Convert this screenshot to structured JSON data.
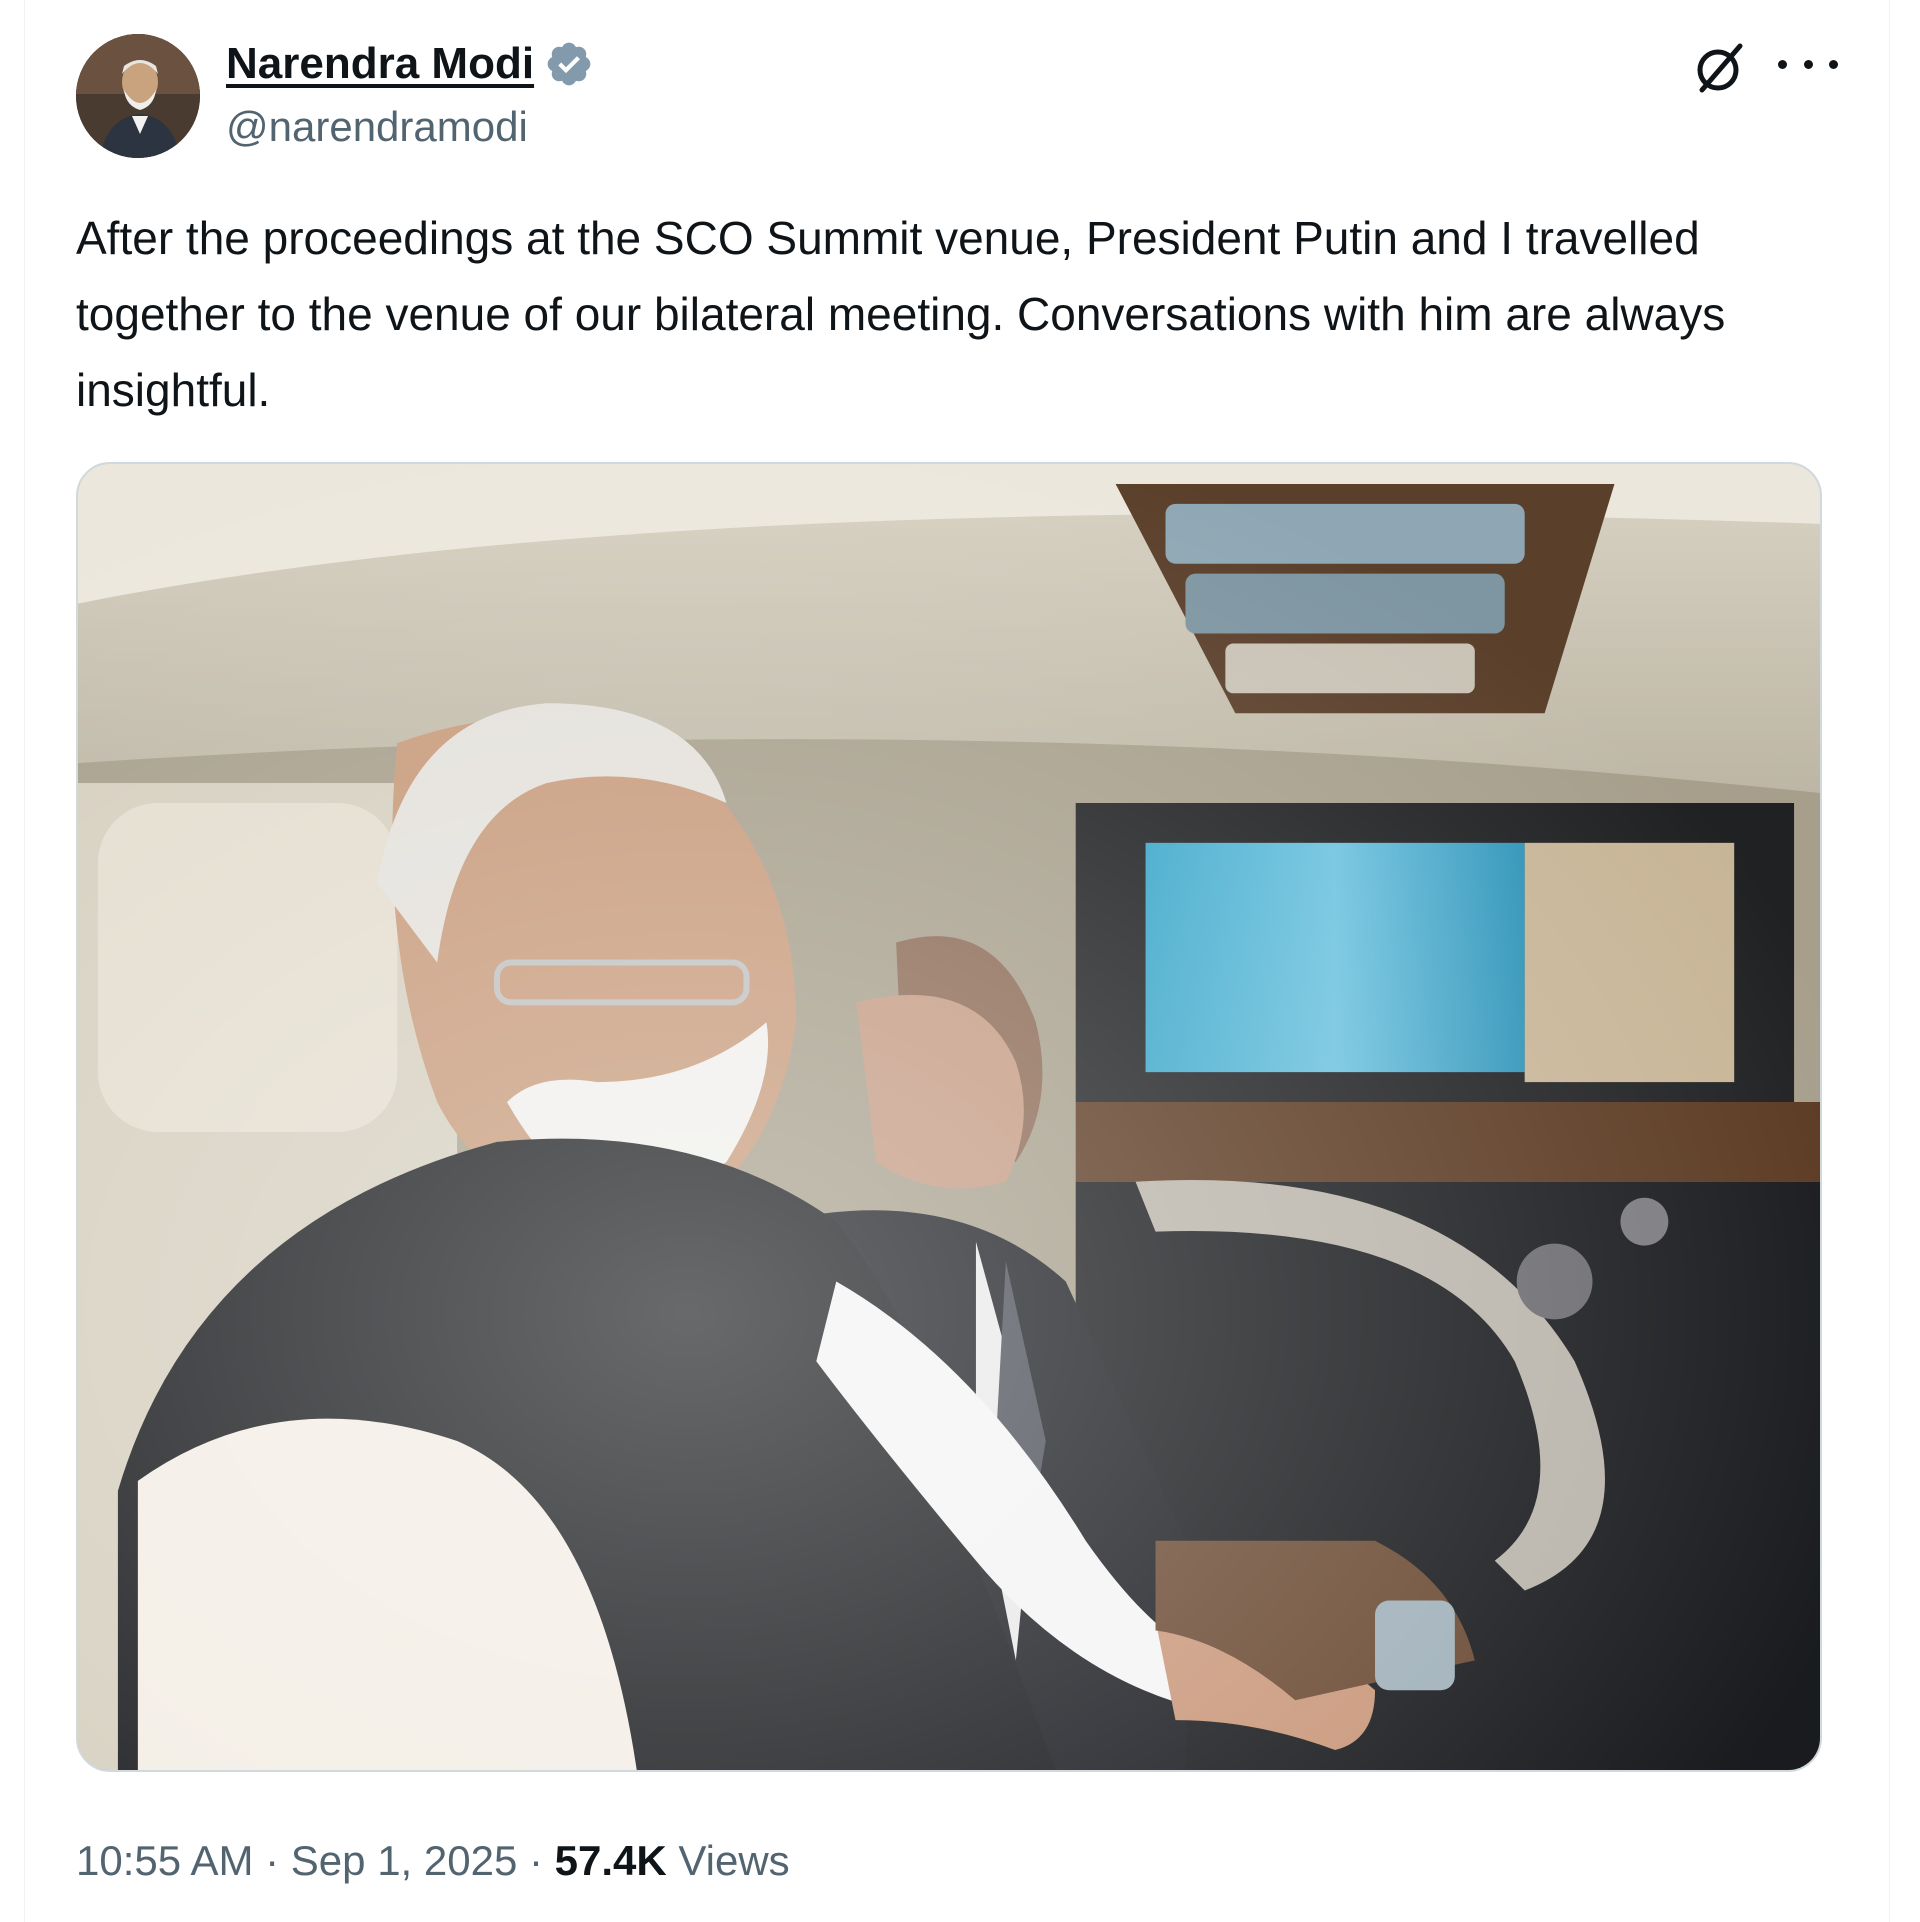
{
  "author": {
    "name": "Narendra Modi",
    "handle": "@narendramodi",
    "verified": true,
    "avatar_icon": "profile-photo",
    "verified_icon": "verified-badge-icon",
    "verified_color": "#829aab"
  },
  "header_actions": {
    "grok_icon": "grok-icon",
    "more_icon": "more-options-icon"
  },
  "tweet": {
    "text": "After the proceedings at the SCO Summit venue, President Putin and I travelled together to the venue of our bilateral meeting. Conversations with him are always insightful.",
    "media": {
      "type": "photo",
      "description_visible": false
    }
  },
  "meta": {
    "time": "10:55 AM",
    "separator": " · ",
    "date": "Sep 1, 2025",
    "views_count": "57.4K",
    "views_label": " Views"
  },
  "colors": {
    "text_primary": "#0f1419",
    "text_secondary": "#536471",
    "border": "#cfd9de"
  }
}
